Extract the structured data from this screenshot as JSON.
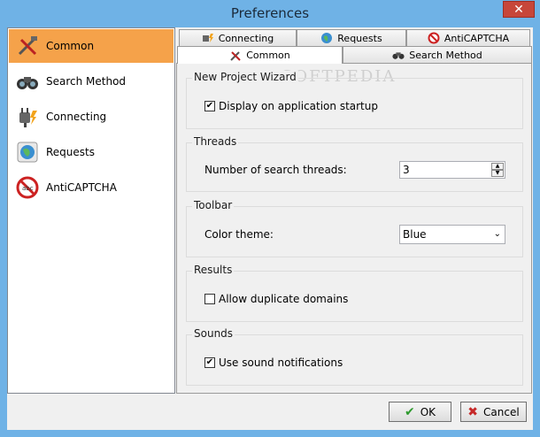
{
  "window": {
    "title": "Preferences",
    "close_glyph": "✕"
  },
  "sidebar": {
    "items": [
      {
        "label": "Common",
        "icon": "tools-icon",
        "selected": true
      },
      {
        "label": "Search Method",
        "icon": "binoculars-icon",
        "selected": false
      },
      {
        "label": "Connecting",
        "icon": "plug-icon",
        "selected": false
      },
      {
        "label": "Requests",
        "icon": "globe-icon",
        "selected": false
      },
      {
        "label": "AntiCAPTCHA",
        "icon": "no-captcha-icon",
        "selected": false
      }
    ]
  },
  "tabs": {
    "top_row": [
      {
        "label": "Connecting",
        "icon": "plug-icon"
      },
      {
        "label": "Requests",
        "icon": "globe-icon"
      },
      {
        "label": "AntiCAPTCHA",
        "icon": "no-captcha-icon"
      }
    ],
    "bottom_row": [
      {
        "label": "Common",
        "icon": "tools-icon",
        "active": true
      },
      {
        "label": "Search Method",
        "icon": "binoculars-icon",
        "active": false
      }
    ]
  },
  "panel": {
    "watermark": "SOFTPEDIA",
    "groups": {
      "wizard": {
        "title": "New Project Wizard",
        "checkbox_label": "Display on application startup",
        "checked": true
      },
      "threads": {
        "title": "Threads",
        "field_label": "Number of search threads:",
        "value": "3"
      },
      "toolbar": {
        "title": "Toolbar",
        "field_label": "Color theme:",
        "value": "Blue"
      },
      "results": {
        "title": "Results",
        "checkbox_label": "Allow duplicate domains",
        "checked": false
      },
      "sounds": {
        "title": "Sounds",
        "checkbox_label": "Use sound notifications",
        "checked": true
      }
    }
  },
  "buttons": {
    "ok": "OK",
    "cancel": "Cancel"
  },
  "glyphs": {
    "check": "✔",
    "up": "▲",
    "down": "▼",
    "dropdown": "⌄",
    "ok_icon": "✔",
    "cancel_icon": "✖"
  },
  "colors": {
    "titlebar": "#6fb2e6",
    "selected": "#f5a24a",
    "close": "#c7463a"
  }
}
